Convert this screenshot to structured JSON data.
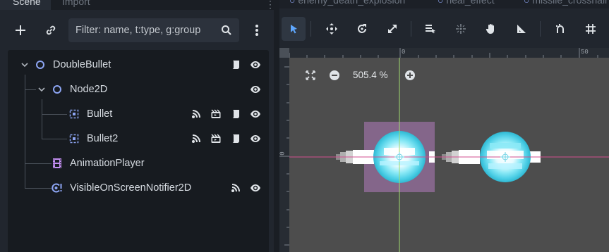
{
  "dock": {
    "tabs": [
      {
        "label": "Scene",
        "active": true
      },
      {
        "label": "Import",
        "active": false
      }
    ]
  },
  "filter": {
    "placeholder": "Filter: name, t:type, g:group",
    "value": ""
  },
  "tree": {
    "nodes": [
      {
        "name": "DoubleBullet",
        "type": "Node2D",
        "depth": 0,
        "expanded": true,
        "icons": [
          "script-icon",
          "visibility-icon"
        ]
      },
      {
        "name": "Node2D",
        "type": "Node2D",
        "depth": 1,
        "expanded": true,
        "icons": [
          "visibility-icon"
        ]
      },
      {
        "name": "Bullet",
        "type": "Area2D",
        "depth": 2,
        "icons": [
          "signal-icon",
          "instance-icon",
          "script-icon",
          "visibility-icon"
        ]
      },
      {
        "name": "Bullet2",
        "type": "Area2D",
        "depth": 2,
        "icons": [
          "signal-icon",
          "instance-icon",
          "script-icon",
          "visibility-icon"
        ]
      },
      {
        "name": "AnimationPlayer",
        "type": "AnimationPlayer",
        "depth": 1,
        "icons": []
      },
      {
        "name": "VisibleOnScreenNotifier2D",
        "type": "VisibleOnScreenNotifier2D",
        "depth": 1,
        "icons": [
          "signal-icon",
          "visibility-icon"
        ]
      }
    ]
  },
  "viewport": {
    "scene_tabs": [
      "enemy_death_explosion",
      "heal_effect",
      "missile_crosshair"
    ],
    "zoom": "505.4 %",
    "ruler": {
      "top_zero": "0",
      "top_fifty": "50",
      "left_zero": "0"
    }
  },
  "colors": {
    "accent": "#5fa8ff",
    "node2d": "#8da5f3",
    "animation": "#c38ef1",
    "x_axis": "#d14f8f",
    "y_axis": "#9ed96f"
  }
}
